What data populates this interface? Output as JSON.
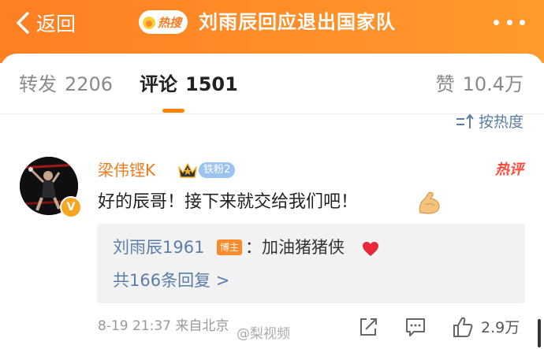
{
  "header": {
    "back_label": "返回",
    "hot_badge": "热搜",
    "title": "刘雨辰回应退出国家队"
  },
  "tabs": {
    "repost": {
      "label": "转发",
      "count": "2206"
    },
    "comment": {
      "label": "评论",
      "count": "1501"
    },
    "like": {
      "label": "赞",
      "count": "10.4万"
    }
  },
  "sort_label": "按热度",
  "comment": {
    "username": "梁伟铿K",
    "fan_badge": "铁粉2",
    "verified_badge": "V",
    "hot_tag": "热评",
    "text": "好的辰哥！接下来就交给我们吧！",
    "emoji": "flexed-biceps-icon",
    "reply": {
      "author": "刘雨辰1961",
      "author_badge": "博主",
      "text": "：加油猪猪侠",
      "emoji": "red-heart-icon",
      "more": "共166条回复 >"
    },
    "time": "8-19 21:37 来自北京",
    "like_count": "2.9万"
  },
  "watermark": "@梨视频",
  "colors": {
    "header_orange": "#ff8a26",
    "accent": "#ff8200",
    "link_blue": "#5b7ea8",
    "username_orange": "#f07b1d",
    "hot_red": "#ff4b3c"
  }
}
